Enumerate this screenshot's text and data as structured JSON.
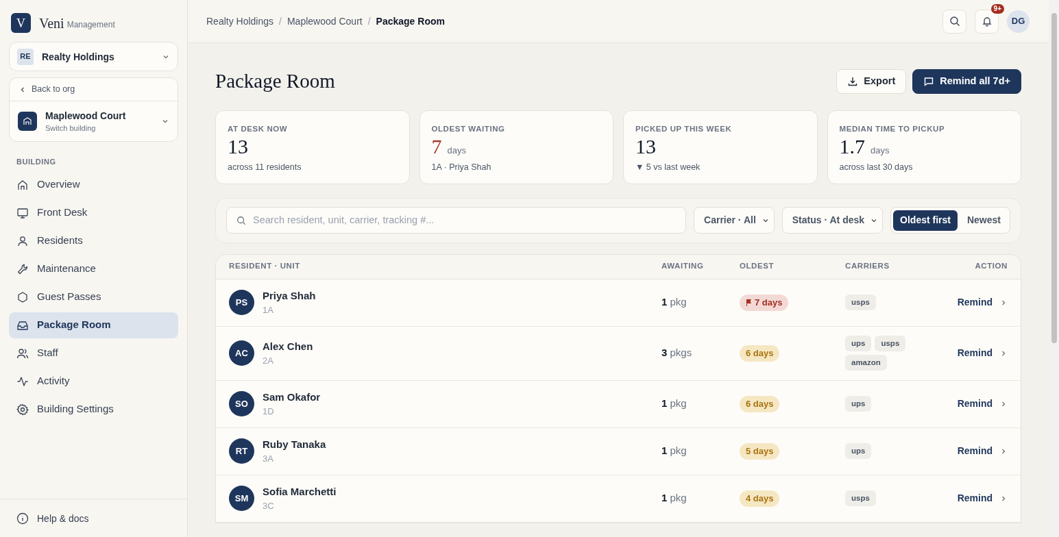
{
  "brand": {
    "logo_letter": "V",
    "name": "Veni",
    "suffix": "Management"
  },
  "org_switcher": {
    "initials": "RE",
    "name": "Realty Holdings"
  },
  "building_card": {
    "back": "Back to org",
    "name": "Maplewood Court",
    "subtitle": "Switch building"
  },
  "sidebar": {
    "section": "BUILDING",
    "items": [
      {
        "label": "Overview",
        "selected": false
      },
      {
        "label": "Front Desk",
        "selected": false
      },
      {
        "label": "Residents",
        "selected": false
      },
      {
        "label": "Maintenance",
        "selected": false
      },
      {
        "label": "Guest Passes",
        "selected": false
      },
      {
        "label": "Package Room",
        "selected": true
      },
      {
        "label": "Staff",
        "selected": false
      },
      {
        "label": "Activity",
        "selected": false
      },
      {
        "label": "Building Settings",
        "selected": false
      }
    ],
    "footer": "Help & docs"
  },
  "breadcrumbs": {
    "items": [
      "Realty Holdings",
      "Maplewood Court",
      "Package Room"
    ],
    "separators": [
      "/",
      "/"
    ]
  },
  "topbar": {
    "notifications": "9+",
    "user_initials": "DG"
  },
  "page": {
    "title": "Package Room",
    "buttons": [
      {
        "kind": "secondary",
        "label": "Export"
      },
      {
        "kind": "primary",
        "label": "Remind all 7d+"
      }
    ]
  },
  "stats": [
    {
      "label": "AT DESK NOW",
      "value": "13",
      "alert": false,
      "note": "across 11 residents"
    },
    {
      "label": "OLDEST WAITING",
      "value": "7",
      "unit": "days",
      "alert": true,
      "note": "1A · Priya Shah"
    },
    {
      "label": "PICKED UP THIS WEEK",
      "value": "13",
      "alert": false,
      "note": "▼ 5 vs last week"
    },
    {
      "label": "MEDIAN TIME TO PICKUP",
      "value": "1.7",
      "unit": "days",
      "alert": false,
      "note": "across last 30 days"
    }
  ],
  "filters": {
    "search_placeholder": "Search resident, unit, carrier, tracking #...",
    "dropdowns": [
      "Carrier · All",
      "Status · At desk"
    ],
    "sort": [
      {
        "label": "Oldest first",
        "selected": true
      },
      {
        "label": "Newest",
        "selected": false
      }
    ]
  },
  "table": {
    "columns": [
      "RESIDENT · UNIT",
      "AWAITING",
      "OLDEST",
      "CARRIERS",
      "ACTION"
    ],
    "rows": [
      {
        "initials": "PS",
        "name": "Priya Shah",
        "unit": "1A",
        "count": "1",
        "count_unit": "pkg",
        "oldest": "7 days",
        "flagged": true,
        "carriers": [
          "usps"
        ],
        "action": "Remind"
      },
      {
        "initials": "AC",
        "name": "Alex Chen",
        "unit": "2A",
        "count": "3",
        "count_unit": "pkgs",
        "oldest": "6 days",
        "flagged": false,
        "carriers": [
          "ups",
          "usps",
          "amazon"
        ],
        "action": "Remind"
      },
      {
        "initials": "SO",
        "name": "Sam Okafor",
        "unit": "1D",
        "count": "1",
        "count_unit": "pkg",
        "oldest": "6 days",
        "flagged": false,
        "carriers": [
          "ups"
        ],
        "action": "Remind"
      },
      {
        "initials": "RT",
        "name": "Ruby Tanaka",
        "unit": "3A",
        "count": "1",
        "count_unit": "pkg",
        "oldest": "5 days",
        "flagged": false,
        "carriers": [
          "ups"
        ],
        "action": "Remind"
      },
      {
        "initials": "SM",
        "name": "Sofia Marchetti",
        "unit": "3C",
        "count": "1",
        "count_unit": "pkg",
        "oldest": "4 days",
        "flagged": false,
        "carriers": [
          "usps"
        ],
        "action": "Remind"
      }
    ]
  }
}
